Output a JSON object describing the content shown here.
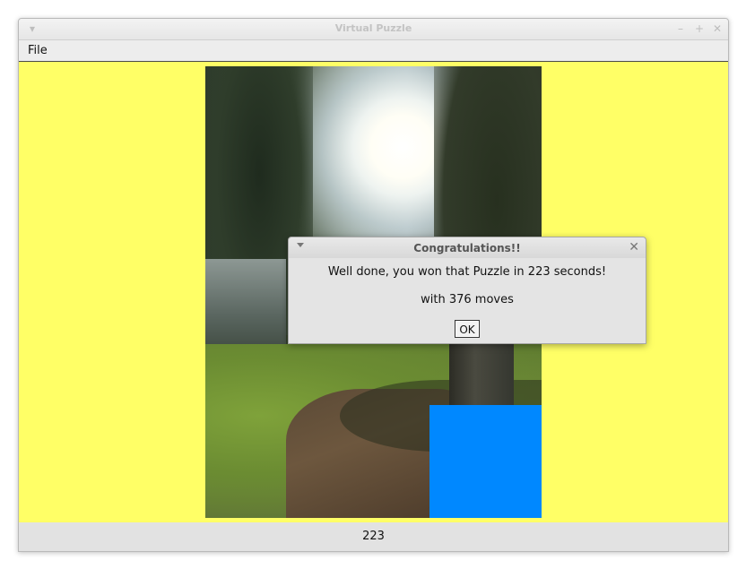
{
  "window": {
    "title": "Virtual Puzzle",
    "controls": {
      "menu_icon": "chevron-down-icon",
      "minimize_icon": "minimize-icon",
      "maximize_icon": "maximize-icon",
      "close_icon": "close-icon"
    }
  },
  "menubar": {
    "items": [
      {
        "label": "File"
      }
    ]
  },
  "puzzle": {
    "image_description_icon": "photo-sun-through-trees",
    "background_color": "#ffff66",
    "empty_tile_color": "#0088ff"
  },
  "statusbar": {
    "elapsed_seconds": "223"
  },
  "dialog": {
    "title": "Congratulations!!",
    "message": "Well done, you won that Puzzle in 223 seconds!",
    "moves": "with 376 moves",
    "ok_label": "OK"
  }
}
